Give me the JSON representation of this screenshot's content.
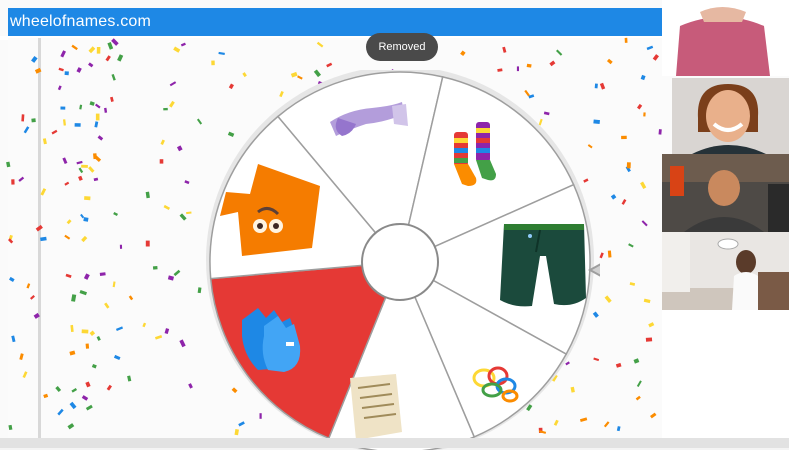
{
  "browser": {
    "site_name": "wheelofnames.com"
  },
  "toast": {
    "text": "Removed"
  },
  "wheel": {
    "segments": [
      {
        "item": "scarf-icon",
        "fill": "#ffffff"
      },
      {
        "item": "socks-icon",
        "fill": "#ffffff"
      },
      {
        "item": "shorts-icon",
        "fill": "#ffffff"
      },
      {
        "item": "hair-ties-icon",
        "fill": "#ffffff"
      },
      {
        "item": "paper-icon",
        "fill": "#ffffff"
      },
      {
        "item": "gloves-icon",
        "fill": "#e53935"
      },
      {
        "item": "hat-icon",
        "fill": "#ffffff"
      }
    ],
    "pointer": "pointer-icon"
  },
  "video_call": {
    "participants": [
      {
        "name": "participant-1-video"
      },
      {
        "name": "participant-2-video"
      },
      {
        "name": "participant-3-video"
      },
      {
        "name": "participant-4-video"
      }
    ]
  },
  "colors": {
    "top_bar": "#1e88e5",
    "highlight_segment": "#e53935",
    "confetti": [
      "#e53935",
      "#43a047",
      "#1e88e5",
      "#fdd835",
      "#fb8c00",
      "#8e24aa"
    ]
  }
}
